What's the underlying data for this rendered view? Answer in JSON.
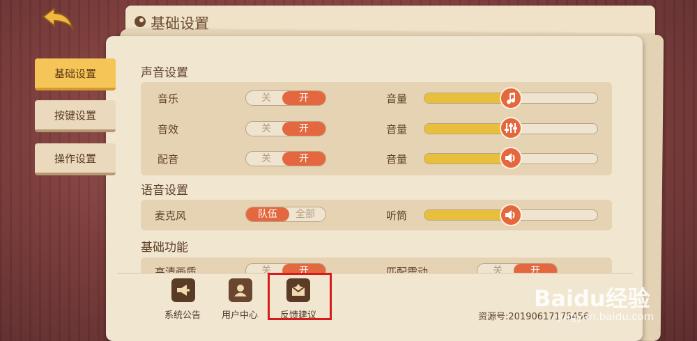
{
  "header": {
    "title": "基础设置",
    "back_icon": "back-arrow-icon"
  },
  "sidebar": {
    "items": [
      {
        "label": "基础设置",
        "active": true
      },
      {
        "label": "按键设置",
        "active": false
      },
      {
        "label": "操作设置",
        "active": false
      }
    ]
  },
  "sections": {
    "sound": {
      "title": "声音设置",
      "rows": [
        {
          "label": "音乐",
          "toggle_off": "关",
          "toggle_on": "开",
          "state": "开",
          "volume_label": "音量",
          "volume": 0.45,
          "knob_icon": "music-note-icon"
        },
        {
          "label": "音效",
          "toggle_off": "关",
          "toggle_on": "开",
          "state": "开",
          "volume_label": "音量",
          "volume": 0.45,
          "knob_icon": "equalizer-icon"
        },
        {
          "label": "配音",
          "toggle_off": "关",
          "toggle_on": "开",
          "state": "开",
          "volume_label": "音量",
          "volume": 0.45,
          "knob_icon": "speaker-icon"
        }
      ]
    },
    "voice": {
      "title": "语音设置",
      "rows": [
        {
          "label": "麦克风",
          "toggle_left": "队伍",
          "toggle_right": "全部",
          "state": "队伍",
          "volume_label": "听筒",
          "volume": 0.45,
          "knob_icon": "speaker-icon"
        }
      ]
    },
    "basic": {
      "title": "基础功能",
      "rows": [
        {
          "label": "高清画质",
          "toggle_off": "关",
          "toggle_on": "开",
          "state": "开"
        },
        {
          "label": "匹配震动",
          "toggle_off": "关",
          "toggle_on": "开",
          "state": "开"
        }
      ]
    }
  },
  "bottom_bar": {
    "buttons": [
      {
        "label": "系统公告",
        "icon": "megaphone-icon"
      },
      {
        "label": "用户中心",
        "icon": "user-icon"
      },
      {
        "label": "反馈建议",
        "icon": "feedback-mail-icon"
      }
    ],
    "resource_number": "资源号:20190617175456"
  },
  "watermark": {
    "brand": "Baidu经验",
    "url": "jingyan.baidu.com"
  },
  "colors": {
    "accent": "#e4683f",
    "slider_fill": "#e8be3d",
    "sidebar_active": "#f6c557",
    "highlight": "#d61b1b"
  }
}
